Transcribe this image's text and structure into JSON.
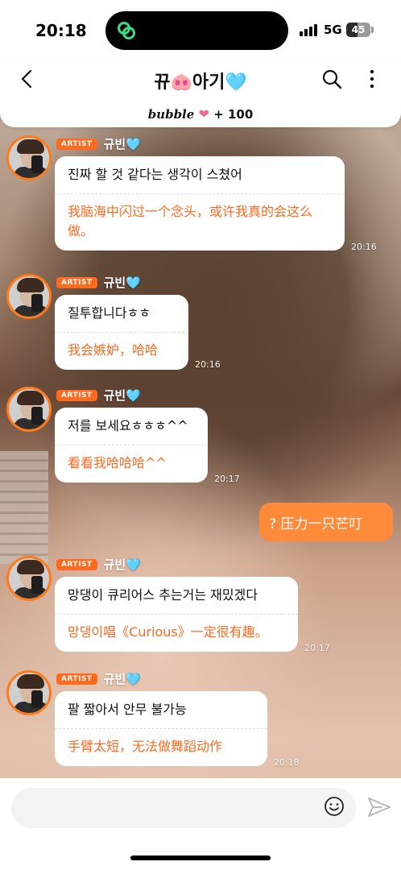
{
  "status": {
    "time": "20:18",
    "network": "5G",
    "battery": "45",
    "battery_level": 0.45
  },
  "header": {
    "title": "뀨🐽아기🩵",
    "bubble_brand": "bubble",
    "bubble_count": "+ 100"
  },
  "messages": [
    {
      "badge": "ARTIST",
      "name": "규빈🩵",
      "ko": "진짜 할 것 같다는 생각이 스쳤어",
      "zh": "我脑海中闪过一个念头，或许我真的会这么做。",
      "time": "20:16"
    },
    {
      "badge": "ARTIST",
      "name": "규빈🩵",
      "ko": "질투합니다ㅎㅎ",
      "zh": "我会嫉妒，哈哈",
      "time": "20:16"
    },
    {
      "badge": "ARTIST",
      "name": "규빈🩵",
      "ko": "저를 보세요ㅎㅎㅎ^^",
      "zh": "看看我哈哈哈^^",
      "time": "20:17"
    },
    {
      "badge": "ARTIST",
      "name": "규빈🩵",
      "ko": "망댕이 큐리어스 추는거는 재밌겠다",
      "zh": "망댕이唱《Curious》一定很有趣。",
      "time": "20:17"
    },
    {
      "badge": "ARTIST",
      "name": "규빈🩵",
      "ko": "팔 짧아서 안무 불가능",
      "zh": "手臂太短，无法做舞蹈动作",
      "time": "20:18"
    }
  ],
  "my_message": "? 压力一只芒叮",
  "input": {
    "placeholder": ""
  },
  "colors": {
    "accent": "#ff6a1f",
    "my_bubble": "#ff8a3a"
  }
}
